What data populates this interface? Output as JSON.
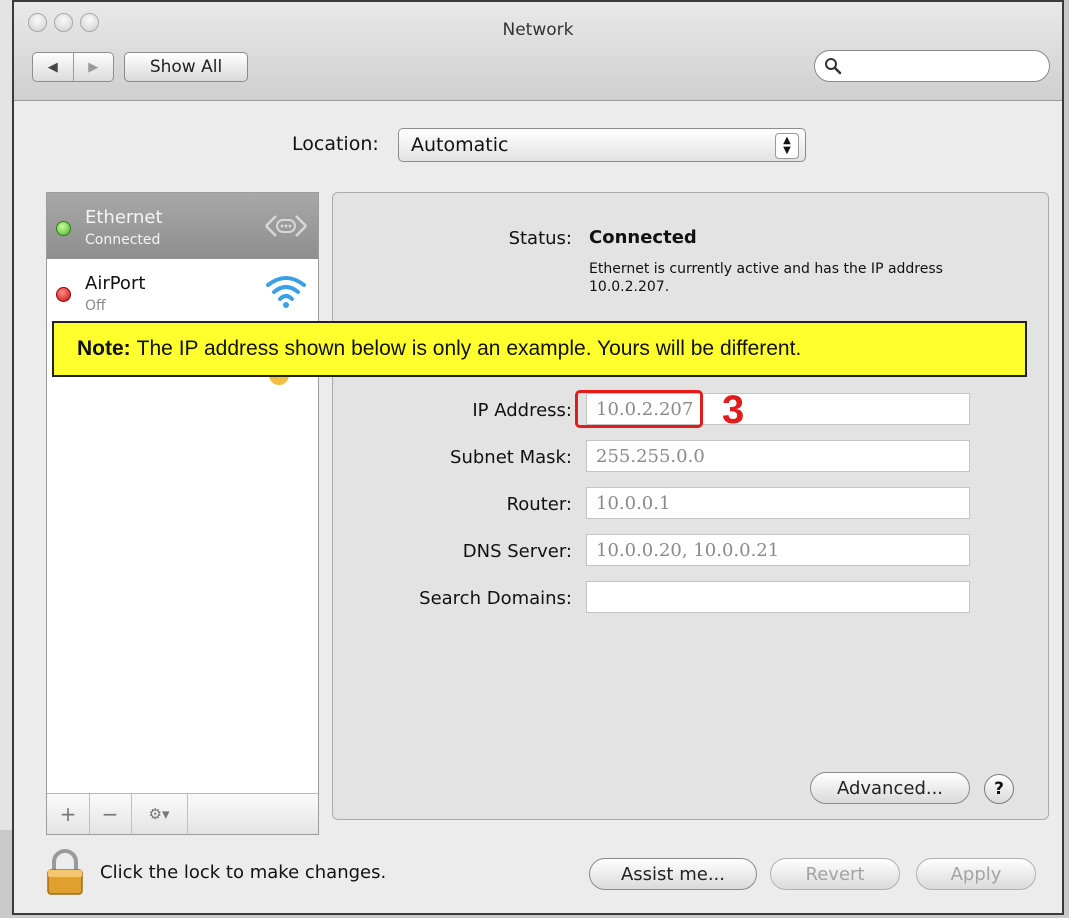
{
  "window": {
    "title": "Network"
  },
  "toolbar": {
    "back_icon": "◀",
    "forward_icon": "▶",
    "show_all_label": "Show All",
    "search_placeholder": ""
  },
  "location": {
    "label": "Location:",
    "value": "Automatic"
  },
  "sidebar": {
    "services": [
      {
        "name": "Ethernet",
        "status": "Connected",
        "indicator": "#4caf2a",
        "icon": "ethernet-icon",
        "selected": true
      },
      {
        "name": "AirPort",
        "status": "Off",
        "indicator": "#d81616",
        "icon": "wifi-icon",
        "selected": false
      }
    ],
    "buttons": {
      "add": "+",
      "remove": "−",
      "action": "⚙▾"
    }
  },
  "details": {
    "status_label": "Status:",
    "status_value": "Connected",
    "status_description": "Ethernet is currently active and has the IP address 10.0.2.207.",
    "fields": [
      {
        "label": "IP Address:",
        "value": "10.0.2.207"
      },
      {
        "label": "Subnet Mask:",
        "value": "255.255.0.0"
      },
      {
        "label": "Router:",
        "value": "10.0.0.1"
      },
      {
        "label": "DNS Server:",
        "value": "10.0.0.20, 10.0.0.21"
      },
      {
        "label": "Search Domains:",
        "value": ""
      }
    ],
    "advanced_label": "Advanced...",
    "help_label": "?"
  },
  "annotation": {
    "note_bold": "Note:",
    "note_text": "The IP address shown below is only an example. Yours will be different.",
    "step_number": "3",
    "color": "#e21b1b",
    "note_background": "#ffff2e"
  },
  "footer": {
    "lock_text": "Click the lock to make changes.",
    "assist_label": "Assist me...",
    "revert_label": "Revert",
    "apply_label": "Apply"
  }
}
